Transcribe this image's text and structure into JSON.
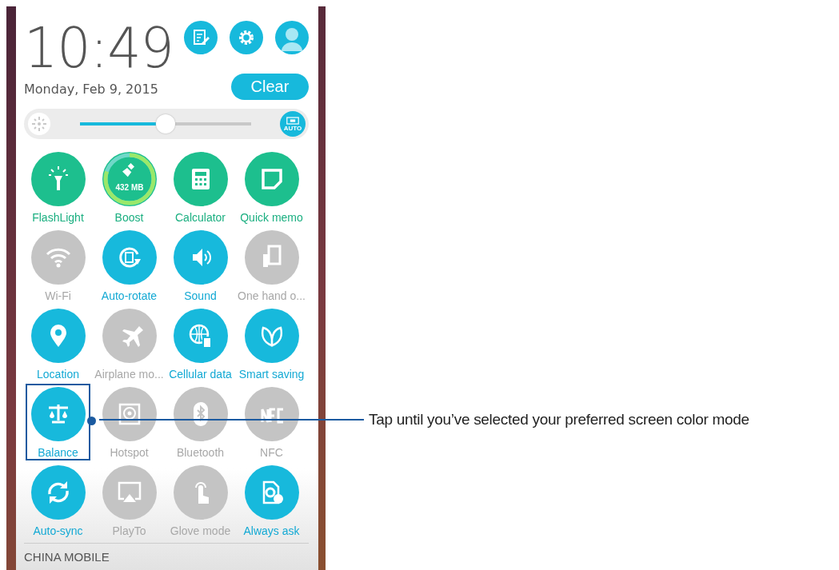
{
  "clock": {
    "time": "10:49",
    "date": "Monday, Feb 9, 2015"
  },
  "clear_button": {
    "label": "Clear"
  },
  "brightness": {
    "level": 0.5,
    "auto_label": "AUTO"
  },
  "boost_meter": {
    "reading": "432 MB",
    "level": 0.8
  },
  "tiles": [
    {
      "label": "FlashLight",
      "kind": "shortcut",
      "on": true,
      "highlighted": false
    },
    {
      "label": "Boost",
      "kind": "boost",
      "on": true,
      "highlighted": false
    },
    {
      "label": "Calculator",
      "kind": "shortcut",
      "on": true,
      "highlighted": false
    },
    {
      "label": "Quick memo",
      "kind": "shortcut",
      "on": true,
      "highlighted": false
    },
    {
      "label": "Wi-Fi",
      "kind": "toggle",
      "on": false,
      "highlighted": false
    },
    {
      "label": "Auto-rotate",
      "kind": "toggle",
      "on": true,
      "highlighted": false
    },
    {
      "label": "Sound",
      "kind": "toggle",
      "on": true,
      "highlighted": false
    },
    {
      "label": "One hand o...",
      "kind": "toggle",
      "on": false,
      "highlighted": false
    },
    {
      "label": "Location",
      "kind": "toggle",
      "on": true,
      "highlighted": false
    },
    {
      "label": "Airplane mo...",
      "kind": "toggle",
      "on": false,
      "highlighted": false
    },
    {
      "label": "Cellular data",
      "kind": "toggle",
      "on": true,
      "highlighted": false
    },
    {
      "label": "Smart saving",
      "kind": "toggle",
      "on": true,
      "highlighted": false
    },
    {
      "label": "Balance",
      "kind": "toggle",
      "on": true,
      "highlighted": true
    },
    {
      "label": "Hotspot",
      "kind": "toggle",
      "on": false,
      "highlighted": false
    },
    {
      "label": "Bluetooth",
      "kind": "toggle",
      "on": false,
      "highlighted": false
    },
    {
      "label": "NFC",
      "kind": "toggle",
      "on": false,
      "highlighted": false
    },
    {
      "label": "Auto-sync",
      "kind": "toggle",
      "on": true,
      "highlighted": false
    },
    {
      "label": "PlayTo",
      "kind": "toggle",
      "on": false,
      "highlighted": false
    },
    {
      "label": "Glove mode",
      "kind": "toggle",
      "on": false,
      "highlighted": false
    },
    {
      "label": "Always ask",
      "kind": "toggle",
      "on": true,
      "highlighted": false
    }
  ],
  "carrier": "CHINA MOBILE",
  "callout": {
    "text": "Tap until you’ve selected your preferred screen color mode"
  }
}
